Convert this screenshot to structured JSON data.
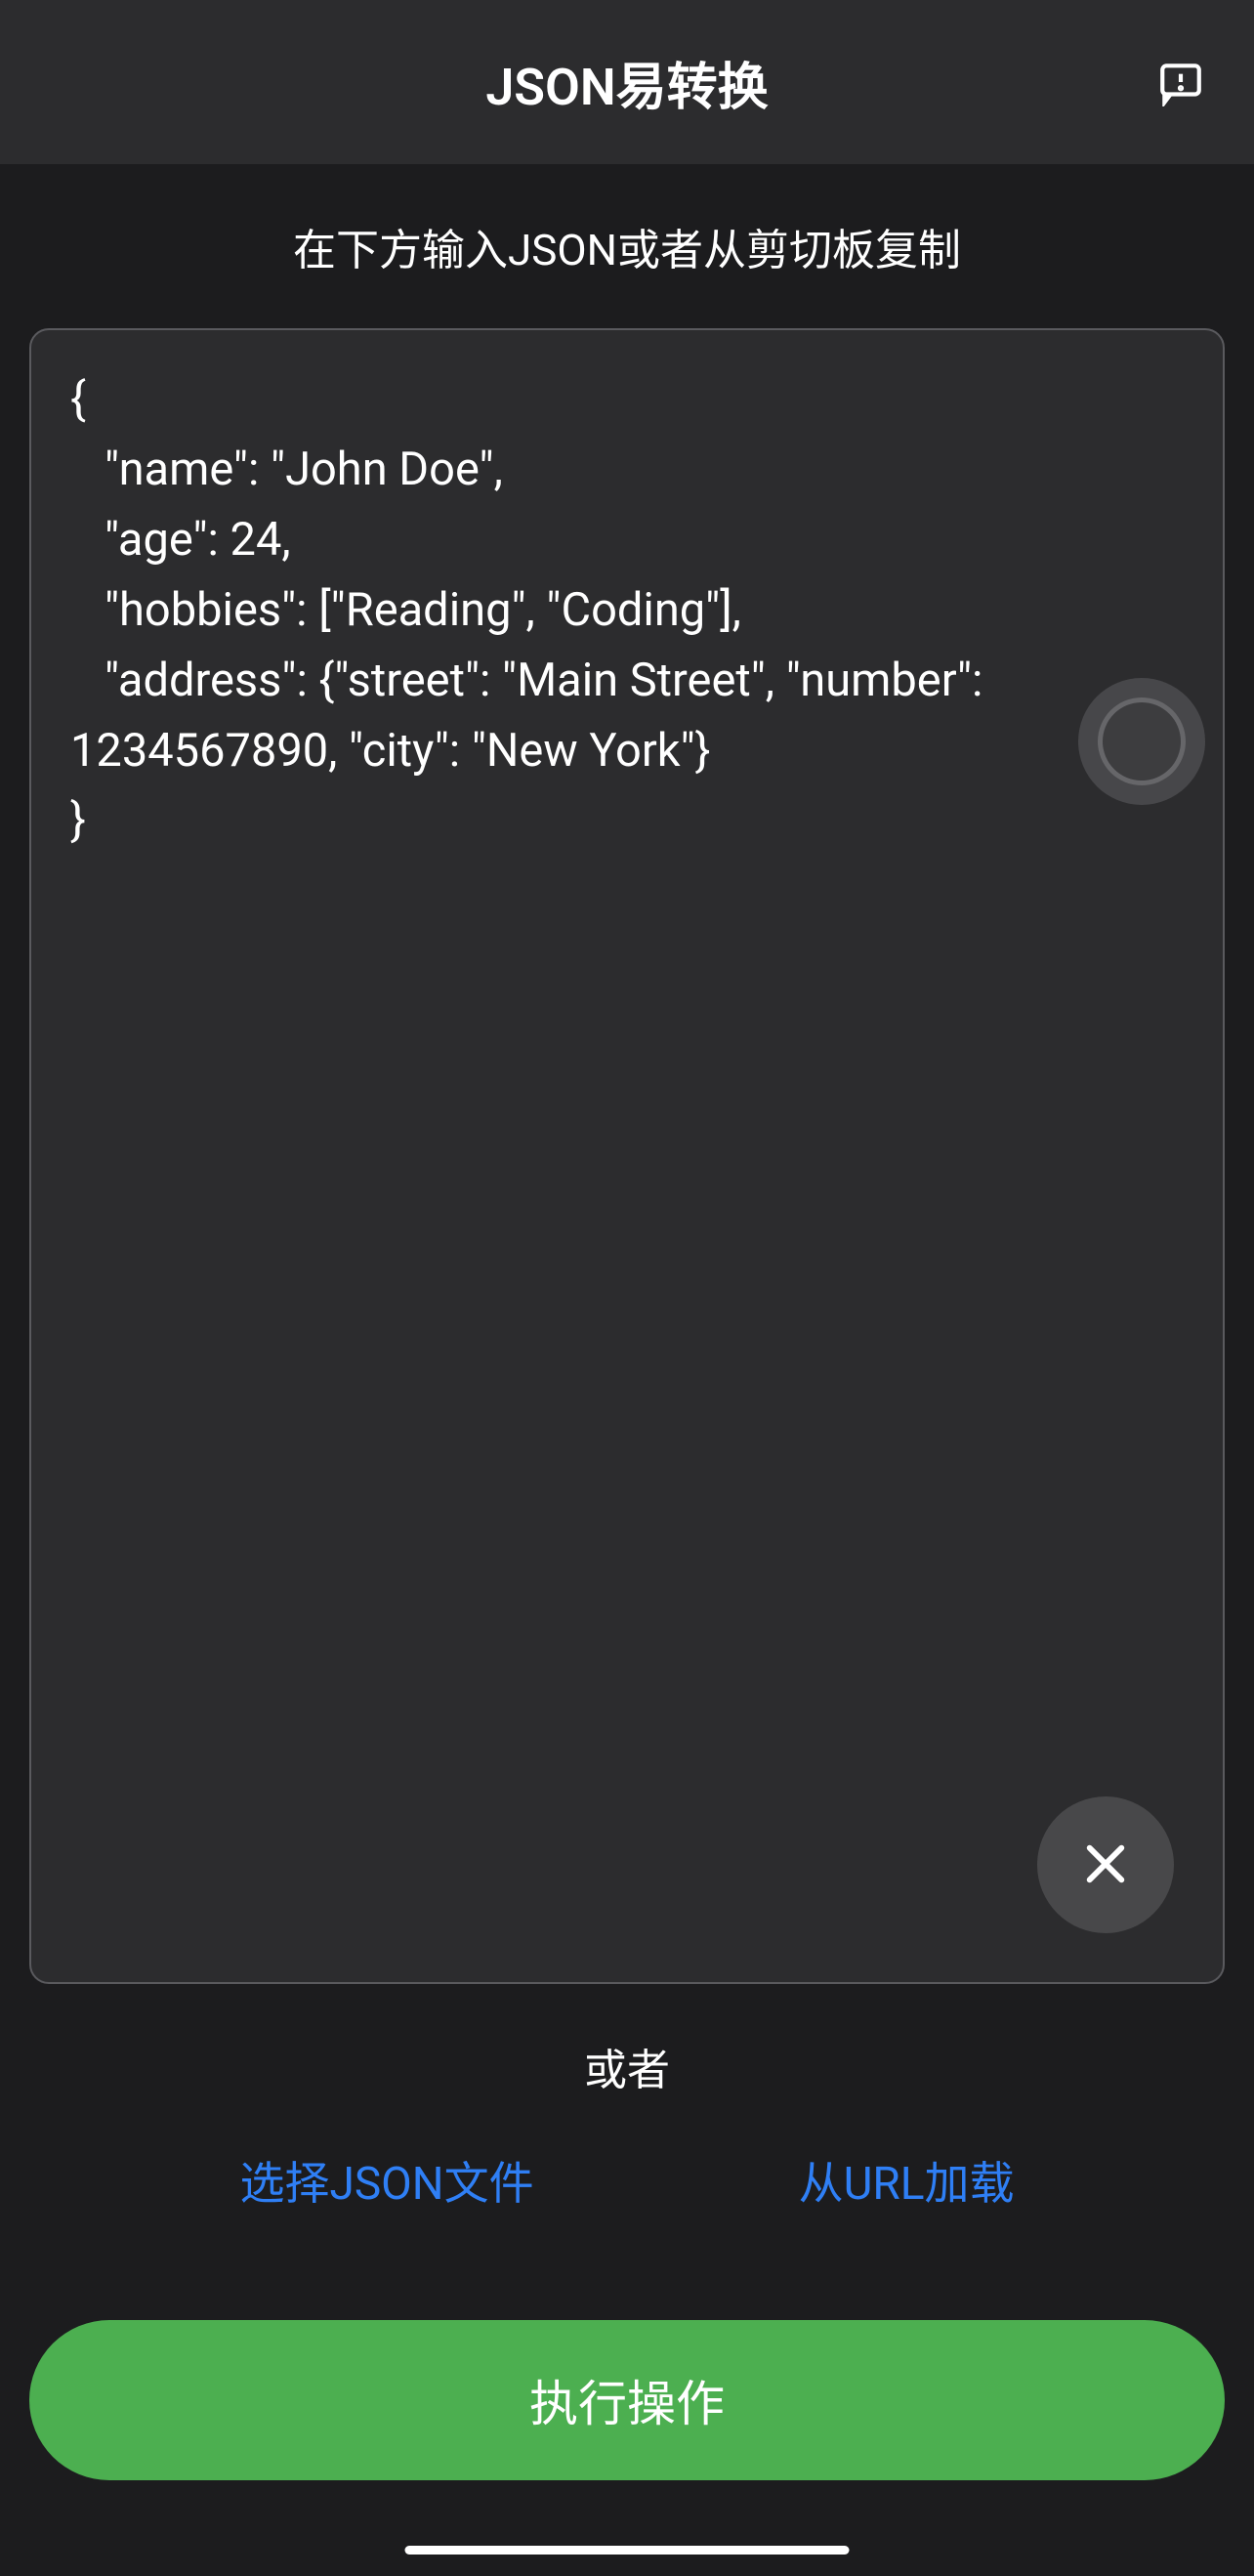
{
  "header": {
    "title": "JSON易转换"
  },
  "main": {
    "instruction": "在下方输入JSON或者从剪切板复制",
    "json_content": "{\n   \"name\": \"John Doe\",\n   \"age\": 24,\n   \"hobbies\": [\"Reading\", \"Coding\"],\n   \"address\": {\"street\": \"Main Street\", \"number\": 1234567890, \"city\": \"New York\"}\n}",
    "or_text": "或者",
    "select_file_label": "选择JSON文件",
    "load_url_label": "从URL加载",
    "execute_label": "执行操作"
  }
}
